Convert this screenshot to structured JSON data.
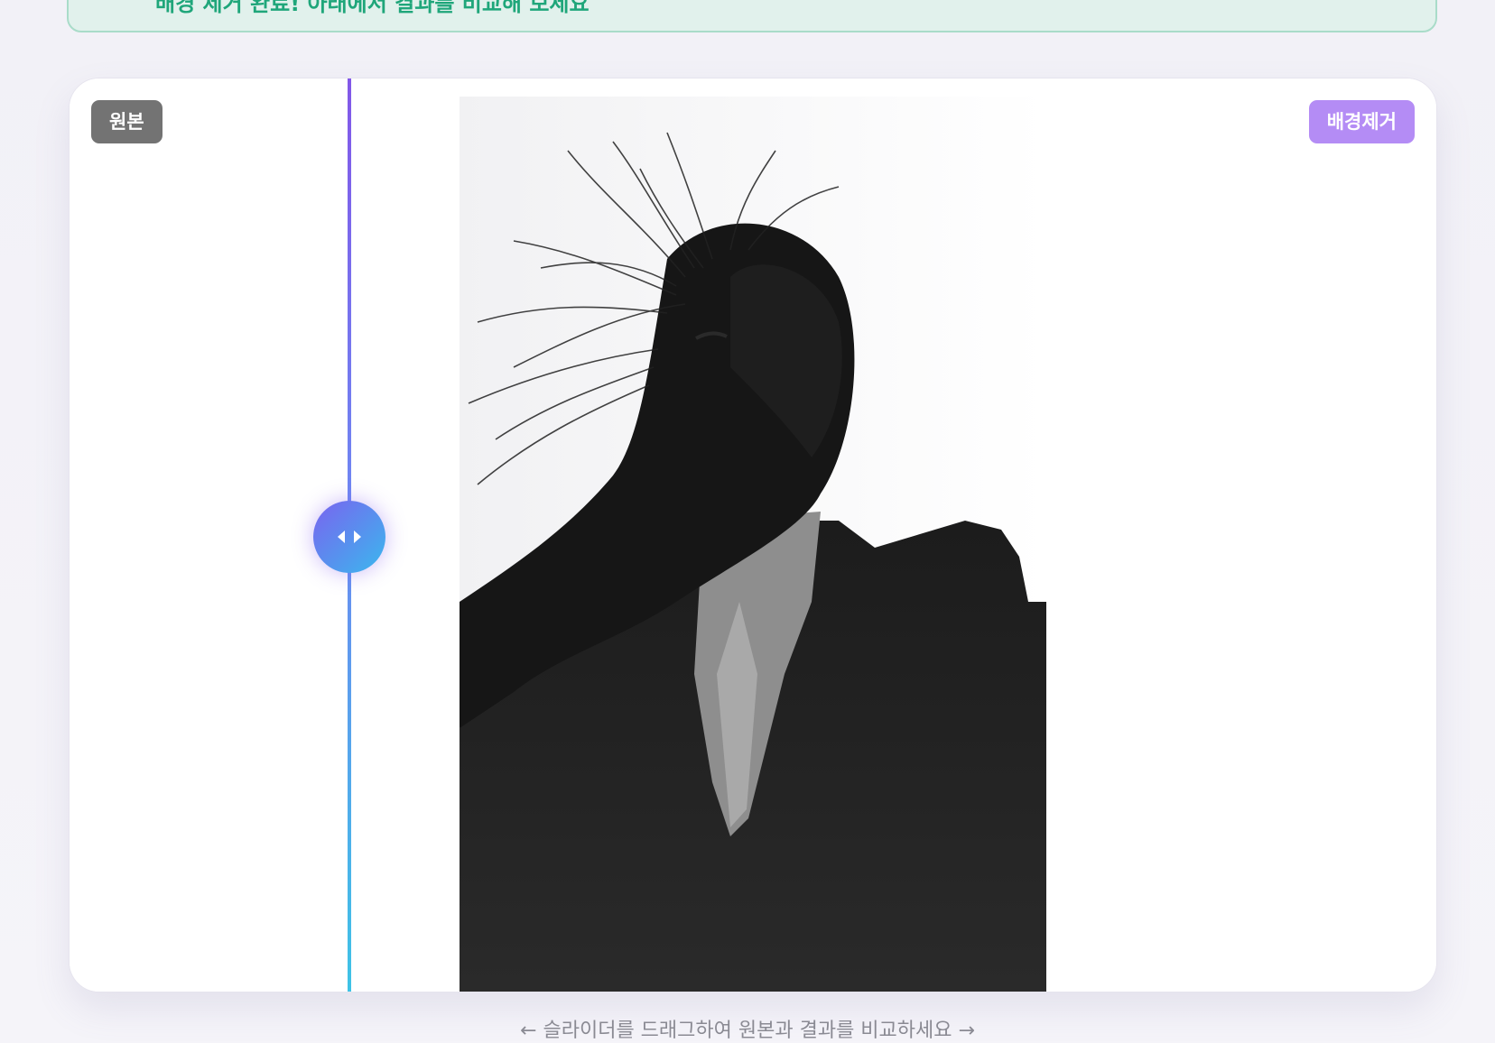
{
  "banner": {
    "text": "배경 제거 완료! 아래에서 결과를 비교해 보세요"
  },
  "compare": {
    "original_label": "원본",
    "result_label": "배경제거",
    "slider_position_percent": 20.5
  },
  "hint": "← 슬라이더를 드래그하여 원본과 결과를 비교하세요 →",
  "colors": {
    "accent_purple": "#8257e8",
    "accent_cyan": "#3ec3e6",
    "badge_result": "#b48cf5",
    "badge_original": "#737373",
    "banner_green": "#1fa67a"
  },
  "icons": {
    "handle": "left-right-arrows-icon"
  }
}
